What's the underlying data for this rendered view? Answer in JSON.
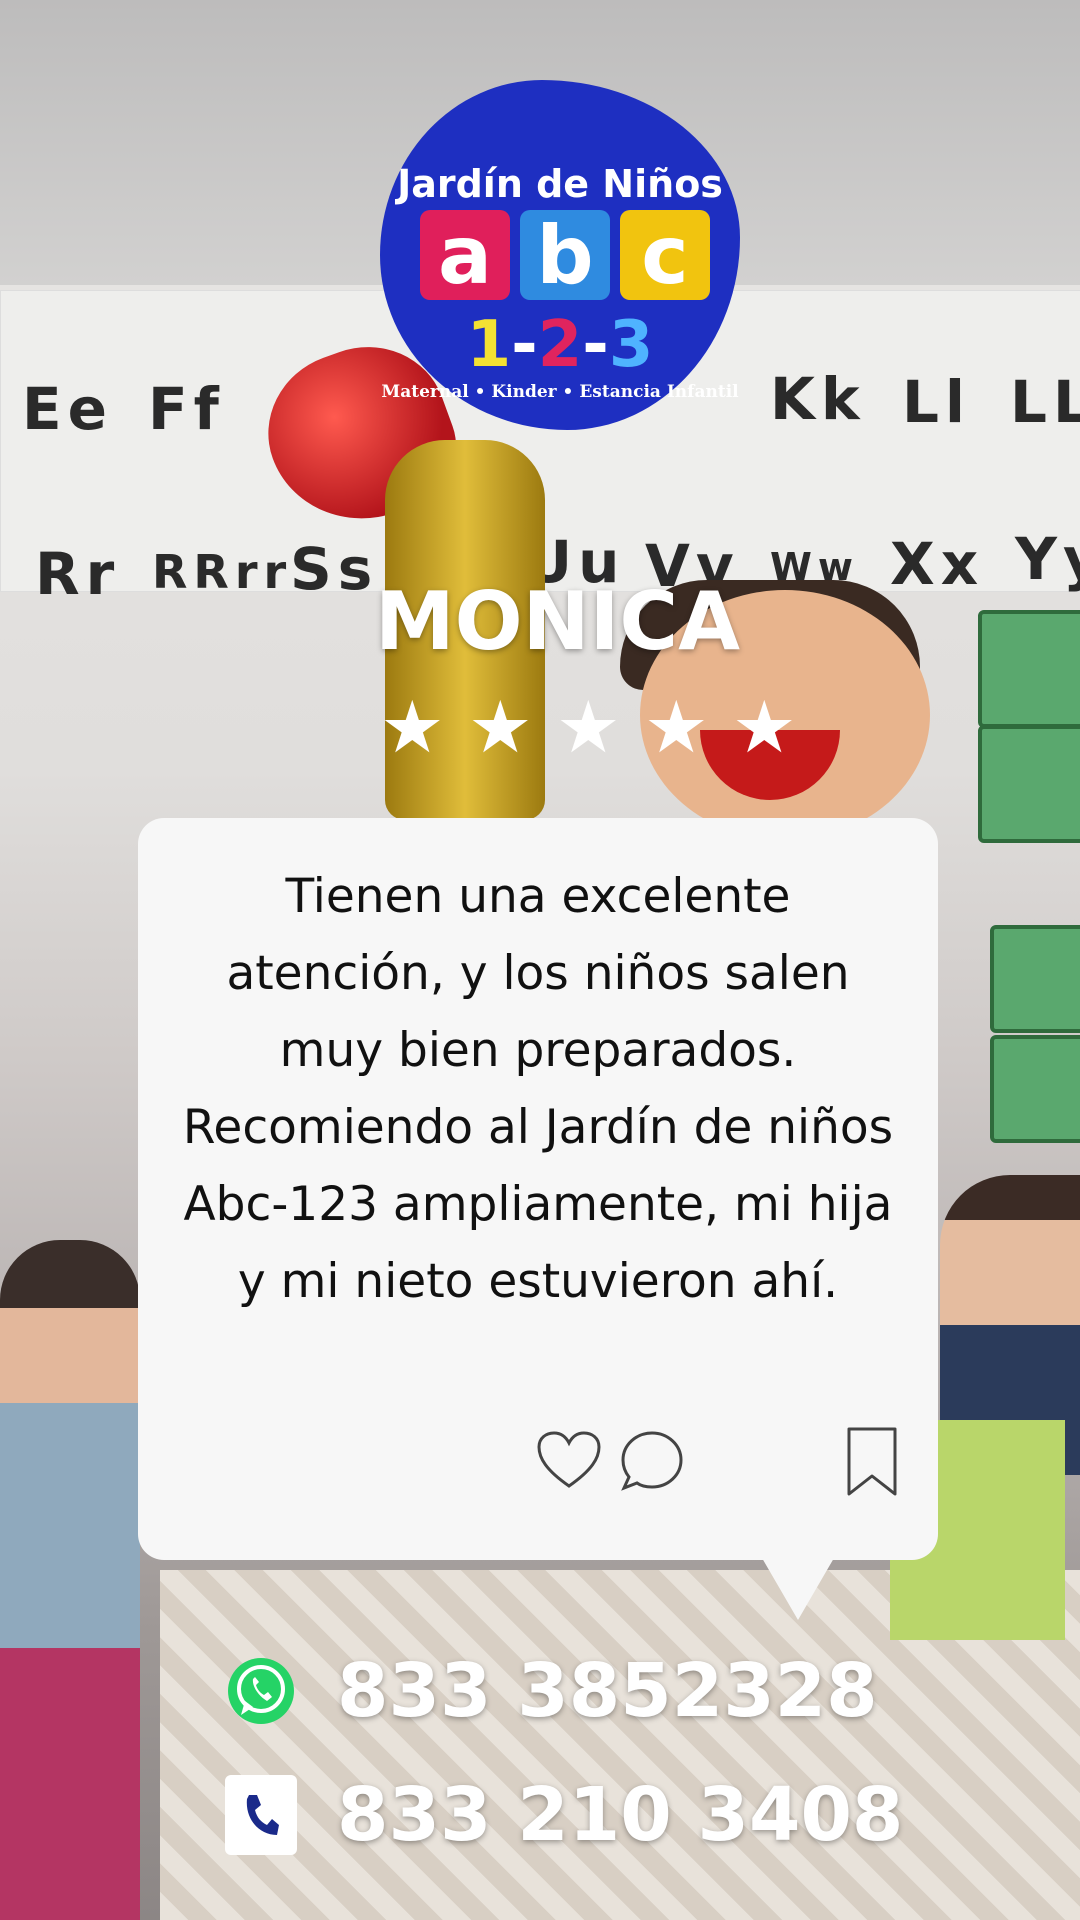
{
  "logo": {
    "title": "Jardín de Niños",
    "letters": [
      "a",
      "b",
      "c"
    ],
    "numbers": "1-2-3",
    "subtitle": "Maternal • Kinder • Estancia Infantil",
    "colors": {
      "splash": "#1e2fc1",
      "a": "#e01f5b",
      "b": "#2f8be0",
      "c": "#f1c40f"
    }
  },
  "background": {
    "wall_letters": [
      "Ee",
      "Ff",
      "Kk",
      "Ll",
      "LLl",
      "Rr",
      "RRrr",
      "Ss",
      "Uu",
      "Vv",
      "Ww",
      "Xx",
      "Yy"
    ]
  },
  "review": {
    "name": "MONICA",
    "stars": 5,
    "text": "Tienen una excelente atención, y los niños salen muy bien preparados. Recomiendo al Jardín de niños Abc-123 ampliamente, mi hija y mi nieto estuvieron ahí.",
    "icons": [
      "heart-icon",
      "comment-icon",
      "bookmark-icon"
    ]
  },
  "contacts": [
    {
      "icon": "whatsapp-icon",
      "number": "833 3852328"
    },
    {
      "icon": "phone-icon",
      "number": "833 210 3408"
    }
  ]
}
